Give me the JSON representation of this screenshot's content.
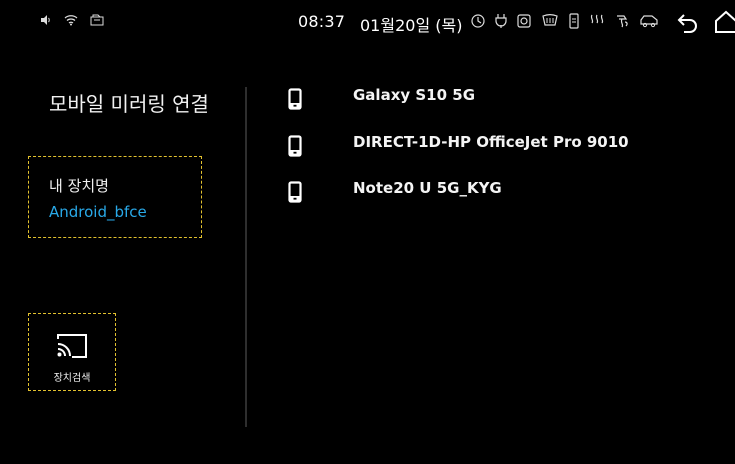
{
  "status_bar": {
    "time": "08:37",
    "date": "01월20일 (목)",
    "left_icons": [
      "volume-icon",
      "wifi-icon",
      "sd-card-icon"
    ],
    "right_icons": [
      "clock-icon",
      "plug-icon",
      "camera-icon",
      "front-defrost-icon",
      "phone-status-icon",
      "heated-seat-icon",
      "ac-icon",
      "car-icon"
    ],
    "nav": [
      "back-icon",
      "home-icon"
    ]
  },
  "left_panel": {
    "title": "모바일 미러링 연결",
    "my_device_label": "내 장치명",
    "my_device_name": "Android_bfce",
    "search_label": "장치검색"
  },
  "colors": {
    "accent_blue": "#29a9e8",
    "dashed_border": "#e2c12e"
  },
  "devices": [
    {
      "name": "Galaxy S10 5G"
    },
    {
      "name": "DIRECT-1D-HP OfficeJet Pro 9010"
    },
    {
      "name": "Note20 U 5G_KYG"
    }
  ]
}
